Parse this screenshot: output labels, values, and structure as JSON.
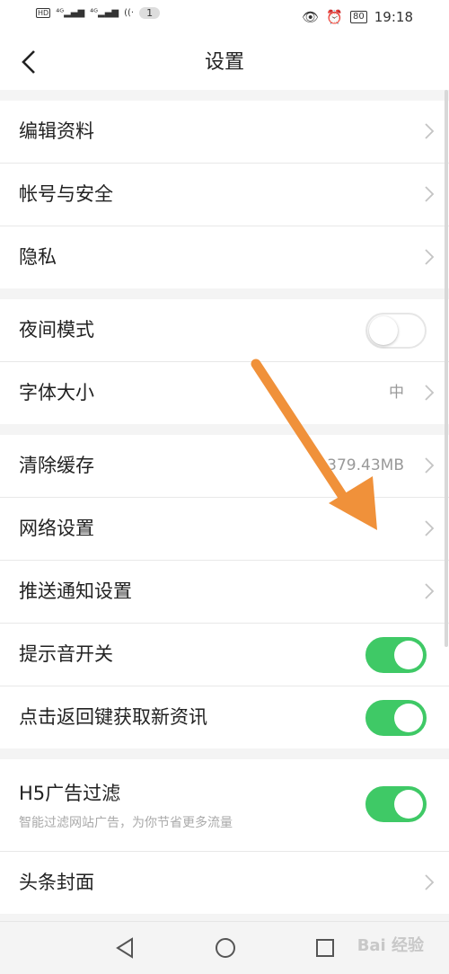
{
  "status_bar": {
    "badge_count": "1",
    "battery": "80",
    "time": "19:18"
  },
  "header": {
    "title": "设置"
  },
  "groups": [
    [
      {
        "label": "编辑资料",
        "type": "link"
      },
      {
        "label": "帐号与安全",
        "type": "link"
      },
      {
        "label": "隐私",
        "type": "link"
      }
    ],
    [
      {
        "label": "夜间模式",
        "type": "toggle",
        "on": false
      },
      {
        "label": "字体大小",
        "type": "link",
        "value": "中"
      }
    ],
    [
      {
        "label": "清除缓存",
        "type": "link",
        "value": "379.43MB"
      },
      {
        "label": "网络设置",
        "type": "link"
      },
      {
        "label": "推送通知设置",
        "type": "link"
      },
      {
        "label": "提示音开关",
        "type": "toggle",
        "on": true
      },
      {
        "label": "点击返回键获取新资讯",
        "type": "toggle",
        "on": true
      }
    ],
    [
      {
        "label": "H5广告过滤",
        "type": "toggle",
        "on": true,
        "subtitle": "智能过滤网站广告，为你节省更多流量"
      },
      {
        "label": "头条封面",
        "type": "link"
      }
    ]
  ],
  "colors": {
    "toggle_on": "#3fc966",
    "annotation_arrow": "#f0913a"
  },
  "watermark": "Bai 经验"
}
